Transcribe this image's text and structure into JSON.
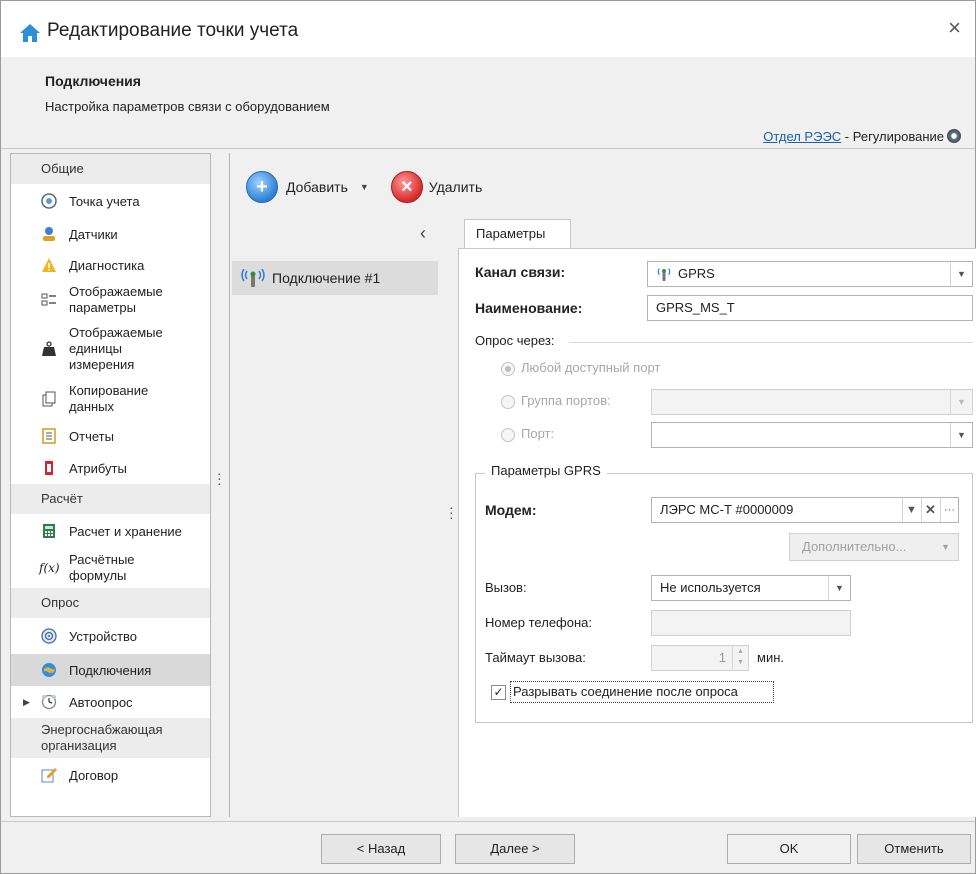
{
  "window": {
    "title": "Редактирование точки учета",
    "close_symbol": "×",
    "icon": "home-icon"
  },
  "header": {
    "title": "Подключения",
    "subtitle": "Настройка параметров связи с оборудованием",
    "department_link": "Отдел РЭЭС",
    "department_suffix": " - Регулирование"
  },
  "nav": {
    "groups": [
      {
        "label": "Общие",
        "items": [
          {
            "label": "Точка учета",
            "icon": "meter-point-icon"
          },
          {
            "label": "Датчики",
            "icon": "sensor-icon"
          },
          {
            "label": "Диагностика",
            "icon": "warning-icon"
          },
          {
            "label": "Отображаемые параметры",
            "icon": "parameters-list-icon"
          },
          {
            "label": "Отображаемые единицы измерения",
            "icon": "weight-icon"
          },
          {
            "label": "Копирование данных",
            "icon": "copy-icon"
          },
          {
            "label": "Отчеты",
            "icon": "report-icon"
          },
          {
            "label": "Атрибуты",
            "icon": "attribute-icon"
          }
        ]
      },
      {
        "label": "Расчёт",
        "items": [
          {
            "label": "Расчет и хранение",
            "icon": "calculator-icon"
          },
          {
            "label": "Расчётные формулы",
            "icon": "formula-icon"
          }
        ]
      },
      {
        "label": "Опрос",
        "items": [
          {
            "label": "Устройство",
            "icon": "device-icon"
          },
          {
            "label": "Подключения",
            "icon": "globe-icon",
            "selected": true
          },
          {
            "label": "Автоопрос",
            "icon": "clock-icon"
          }
        ]
      },
      {
        "label": "Энергоснабжающая организация",
        "items": [
          {
            "label": "Договор",
            "icon": "contract-icon"
          }
        ]
      }
    ]
  },
  "toolbar": {
    "add_label": "Добавить",
    "delete_label": "Удалить"
  },
  "connections": {
    "items": [
      "Подключение #1"
    ]
  },
  "tab": {
    "label": "Параметры"
  },
  "form": {
    "channel_label": "Канал связи:",
    "channel_value": "GPRS",
    "name_label": "Наименование:",
    "name_value": "GPRS_MS_T",
    "poll_via_label": "Опрос через:",
    "radio_any_port": "Любой доступный порт",
    "radio_port_group": "Группа портов:",
    "radio_port": "Порт:",
    "port_group_value": "",
    "port_value": "",
    "gprs_group_title": "Параметры GPRS",
    "modem_label": "Модем:",
    "modem_value": "ЛЭРС МС-Т #0000009",
    "additional_button": "Дополнительно...",
    "call_label": "Вызов:",
    "call_value": "Не используется",
    "phone_label": "Номер телефона:",
    "phone_value": "",
    "timeout_label": "Таймаут вызова:",
    "timeout_value": "1",
    "timeout_unit": "мин.",
    "disconnect_label": "Разрывать соединение после опроса",
    "disconnect_checked": true
  },
  "footer": {
    "back": "< Назад",
    "next": "Далее >",
    "ok": "OK",
    "cancel": "Отменить"
  }
}
